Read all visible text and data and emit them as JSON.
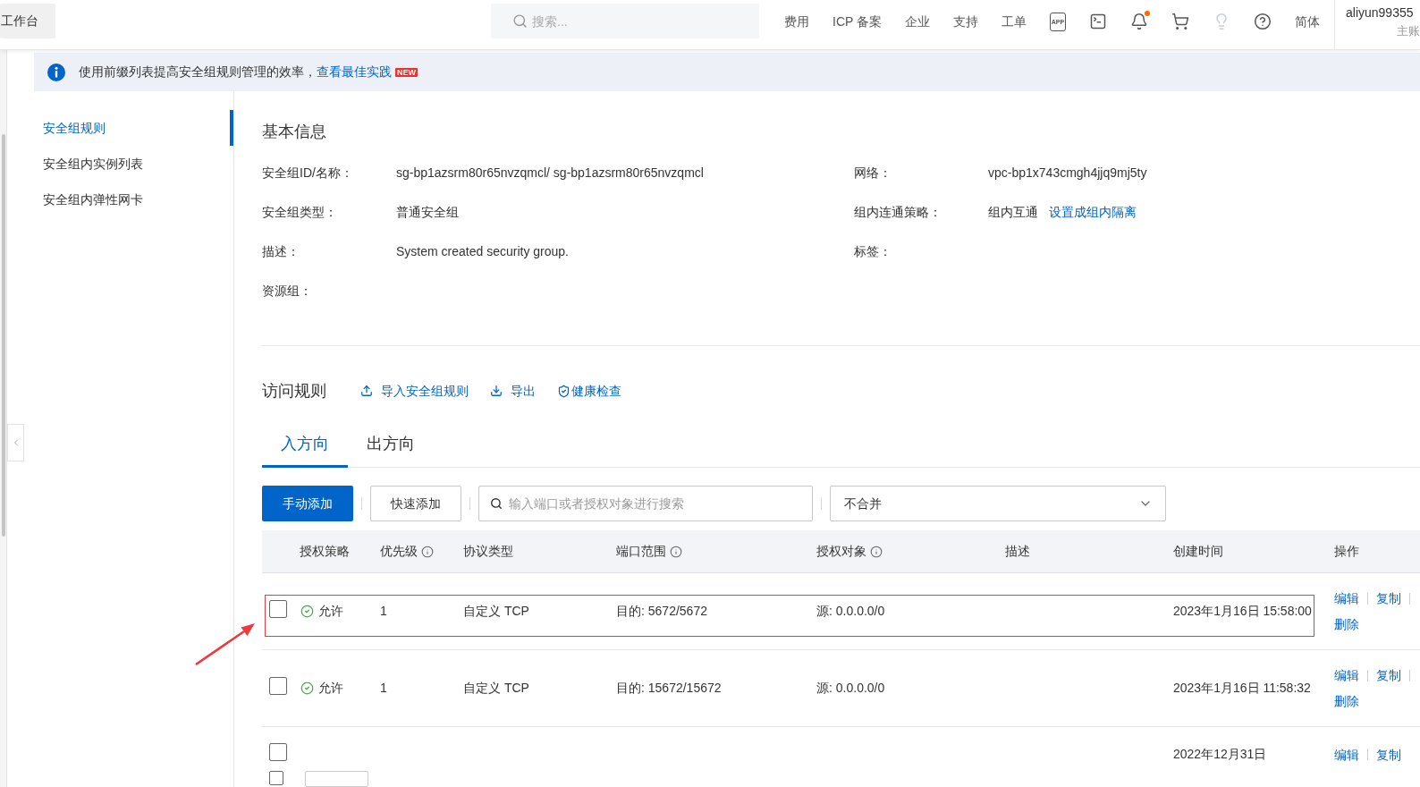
{
  "top_bar": {
    "workbench_button": "工作台",
    "search": {
      "placeholder": "搜索..."
    },
    "nav_links": [
      "费用",
      "ICP 备案",
      "企业",
      "支持",
      "工单"
    ],
    "icons": [
      {
        "kind": "app",
        "text": "APP",
        "badge": false,
        "disabled": false
      },
      {
        "kind": "terminal",
        "badge": false,
        "disabled": false
      },
      {
        "kind": "bell",
        "badge": true,
        "disabled": false
      },
      {
        "kind": "cart",
        "badge": false,
        "disabled": false
      },
      {
        "kind": "bulb",
        "badge": false,
        "disabled": true
      },
      {
        "kind": "help",
        "badge": false,
        "disabled": false
      }
    ],
    "language": "简体",
    "account": {
      "name": "aliyun99355",
      "role": "主账"
    }
  },
  "banner": {
    "text": "使用前缀列表提高安全组规则管理的效率，",
    "link": "查看最佳实践",
    "badge": "NEW"
  },
  "sidebar": {
    "items": [
      {
        "label": "安全组规则",
        "selected": true
      },
      {
        "label": "安全组内实例列表",
        "selected": false
      },
      {
        "label": "安全组内弹性网卡",
        "selected": false
      }
    ]
  },
  "basic_info": {
    "title": "基本信息",
    "fields": [
      {
        "label": "安全组ID/名称：",
        "value": "sg-bp1azsrm80r65nvzqmcl/ sg-bp1azsrm80r65nvzqmcl"
      },
      {
        "label": "网络：",
        "value": "vpc-bp1x743cmgh4jjq9mj5ty"
      },
      {
        "label": "安全组类型：",
        "value": "普通安全组"
      },
      {
        "label": "组内连通策略：",
        "value": "组内互通",
        "link": "设置成组内隔离"
      },
      {
        "label": "描述：",
        "value": "System created security group."
      },
      {
        "label": "标签："
      },
      {
        "label": "资源组："
      }
    ]
  },
  "access_rules": {
    "title": "访问规则",
    "actions": [
      {
        "kind": "import",
        "label": "导入安全组规则"
      },
      {
        "kind": "export",
        "label": "导出"
      },
      {
        "kind": "health_check",
        "label": "健康检查"
      }
    ]
  },
  "direction_tabs": [
    {
      "label": "入方向",
      "selected": true
    },
    {
      "label": "出方向",
      "selected": false
    }
  ],
  "toolbar": {
    "add_button": "手动添加",
    "quick_add_button": "快速添加",
    "search": {
      "placeholder": "输入端口或者授权对象进行搜索"
    },
    "merge_select": {
      "value": "不合并"
    }
  },
  "table": {
    "columns": [
      {
        "label": "授权策略",
        "info": false
      },
      {
        "label": "优先级",
        "info": true
      },
      {
        "label": "协议类型",
        "info": false
      },
      {
        "label": "端口范围",
        "info": true
      },
      {
        "label": "授权对象",
        "info": true
      },
      {
        "label": "描述",
        "info": false
      },
      {
        "label": "创建时间",
        "info": false
      },
      {
        "label": "操作",
        "info": false
      }
    ],
    "rows": [
      {
        "checked": false,
        "highlighted": true,
        "policy": "允许",
        "priority": "1",
        "protocol": "自定义 TCP",
        "port": "目的: 5672/5672",
        "source": "源: 0.0.0.0/0",
        "created": "2023年1月16日 15:58:00",
        "actions": [
          "编辑",
          "复制",
          "删除"
        ]
      },
      {
        "checked": false,
        "highlighted": false,
        "policy": "允许",
        "priority": "1",
        "protocol": "自定义 TCP",
        "port": "目的: 15672/15672",
        "source": "源: 0.0.0.0/0",
        "created": "2023年1月16日 11:58:32",
        "actions": [
          "编辑",
          "复制",
          "删除"
        ]
      },
      {
        "checked": false,
        "highlighted": false,
        "created": "2022年12月31日",
        "actions": [
          "编辑",
          "复制"
        ]
      }
    ]
  },
  "footer": {
    "select_all_checked": false
  }
}
